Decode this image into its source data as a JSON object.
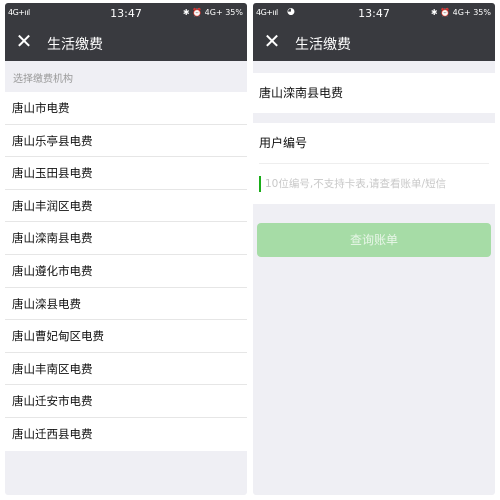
{
  "left": {
    "status": {
      "signal": "4G+ııl",
      "time": "13:47",
      "indicators": "✱ ⏰ 4G+ 35%"
    },
    "header": {
      "title": "生活缴费",
      "close_icon": "close-icon"
    },
    "section_hint": "选择缴费机构",
    "organizations": [
      "唐山市电费",
      "唐山乐亭县电费",
      "唐山玉田县电费",
      "唐山丰润区电费",
      "唐山滦南县电费",
      "唐山遵化市电费",
      "唐山滦县电费",
      "唐山曹妃甸区电费",
      "唐山丰南区电费",
      "唐山迁安市电费",
      "唐山迁西县电费"
    ]
  },
  "right": {
    "status": {
      "signal": "4G+ııl",
      "wechat_icon": "wechat-icon",
      "time": "13:47",
      "indicators": "✱ ⏰ 4G+ 35%"
    },
    "header": {
      "title": "生活缴费",
      "close_icon": "close-icon"
    },
    "organization": "唐山滦南县电费",
    "user_number_label": "用户编号",
    "user_number_placeholder": "10位编号,不支持卡表,请查看账单/短信",
    "query_button": "查询账单"
  }
}
